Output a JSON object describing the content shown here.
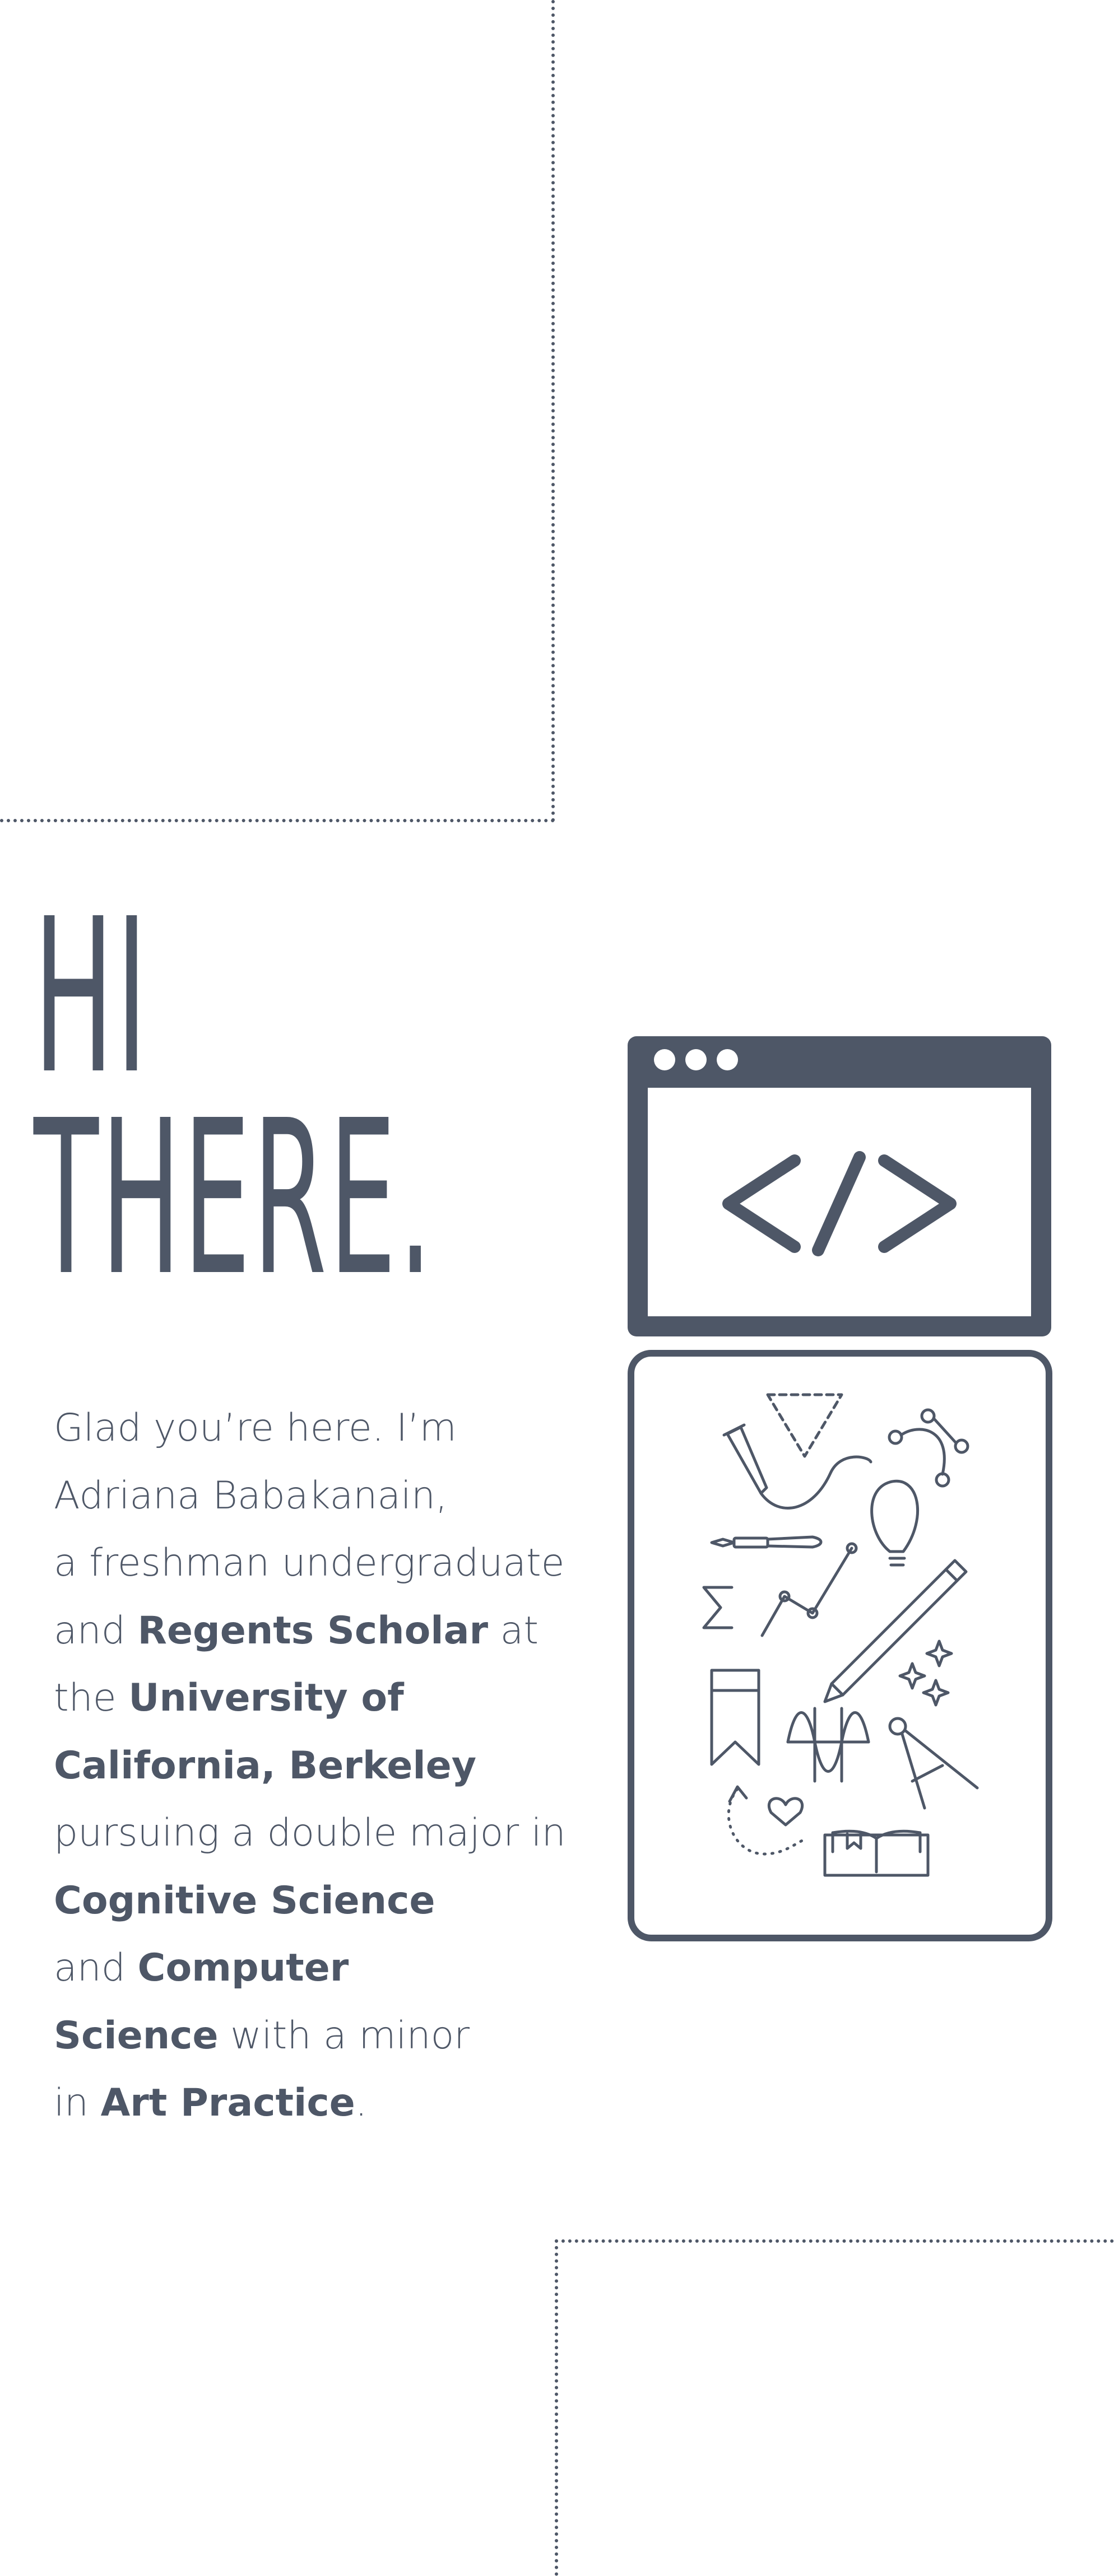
{
  "hero": {
    "headline_line1": "HI",
    "headline_line2": "THERE."
  },
  "intro": {
    "t1": "Glad you’re here. I’m",
    "t2": "Adriana Babakanain,",
    "t3": "a freshman undergraduate",
    "t4": "and ",
    "b1": "Regents Scholar",
    "t5": " at",
    "t6": "the ",
    "b2": "University of",
    "b3": "California, Berkeley",
    "t7": "pursuing a double major in",
    "b4": "Cognitive Science",
    "t8": " and ",
    "b5": "Computer",
    "b6": "Science",
    "t9": " with a minor",
    "t10": "in ",
    "b7": "Art Practice",
    "t11": "."
  },
  "colors": {
    "ink": "#4e5767",
    "background": "#ffffff"
  },
  "icons": {
    "browser": "code-window-icon",
    "tools": "creative-tools-icon"
  }
}
